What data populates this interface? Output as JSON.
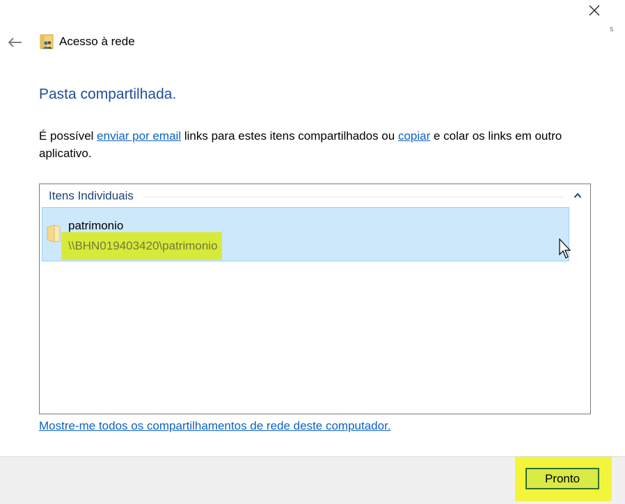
{
  "window": {
    "title": "Acesso à rede",
    "edge_glyph": "s"
  },
  "heading": "Pasta compartilhada.",
  "description": {
    "part1": "É possível ",
    "email_link": "enviar por email",
    "part2": " links para estes itens compartilhados ou ",
    "copy_link": "copiar",
    "part3": " e colar os links em outro aplicativo."
  },
  "list": {
    "group_title": "Itens Individuais",
    "items": [
      {
        "name": "patrimonio",
        "path": "\\\\BHN019403420\\patrimonio"
      }
    ]
  },
  "footer_link": "Mostre-me todos os compartilhamentos de rede deste computador.",
  "buttons": {
    "done": "Pronto"
  },
  "colors": {
    "heading": "#1f4e9a",
    "link": "#0b62c4",
    "selection": "#cde8fb",
    "highlight": "#d7ea3a"
  },
  "icons": {
    "close": "close-icon",
    "back": "back-arrow-icon",
    "title": "network-share-icon",
    "collapse": "chevron-up-icon",
    "folder": "folder-icon",
    "cursor": "mouse-pointer-icon"
  }
}
